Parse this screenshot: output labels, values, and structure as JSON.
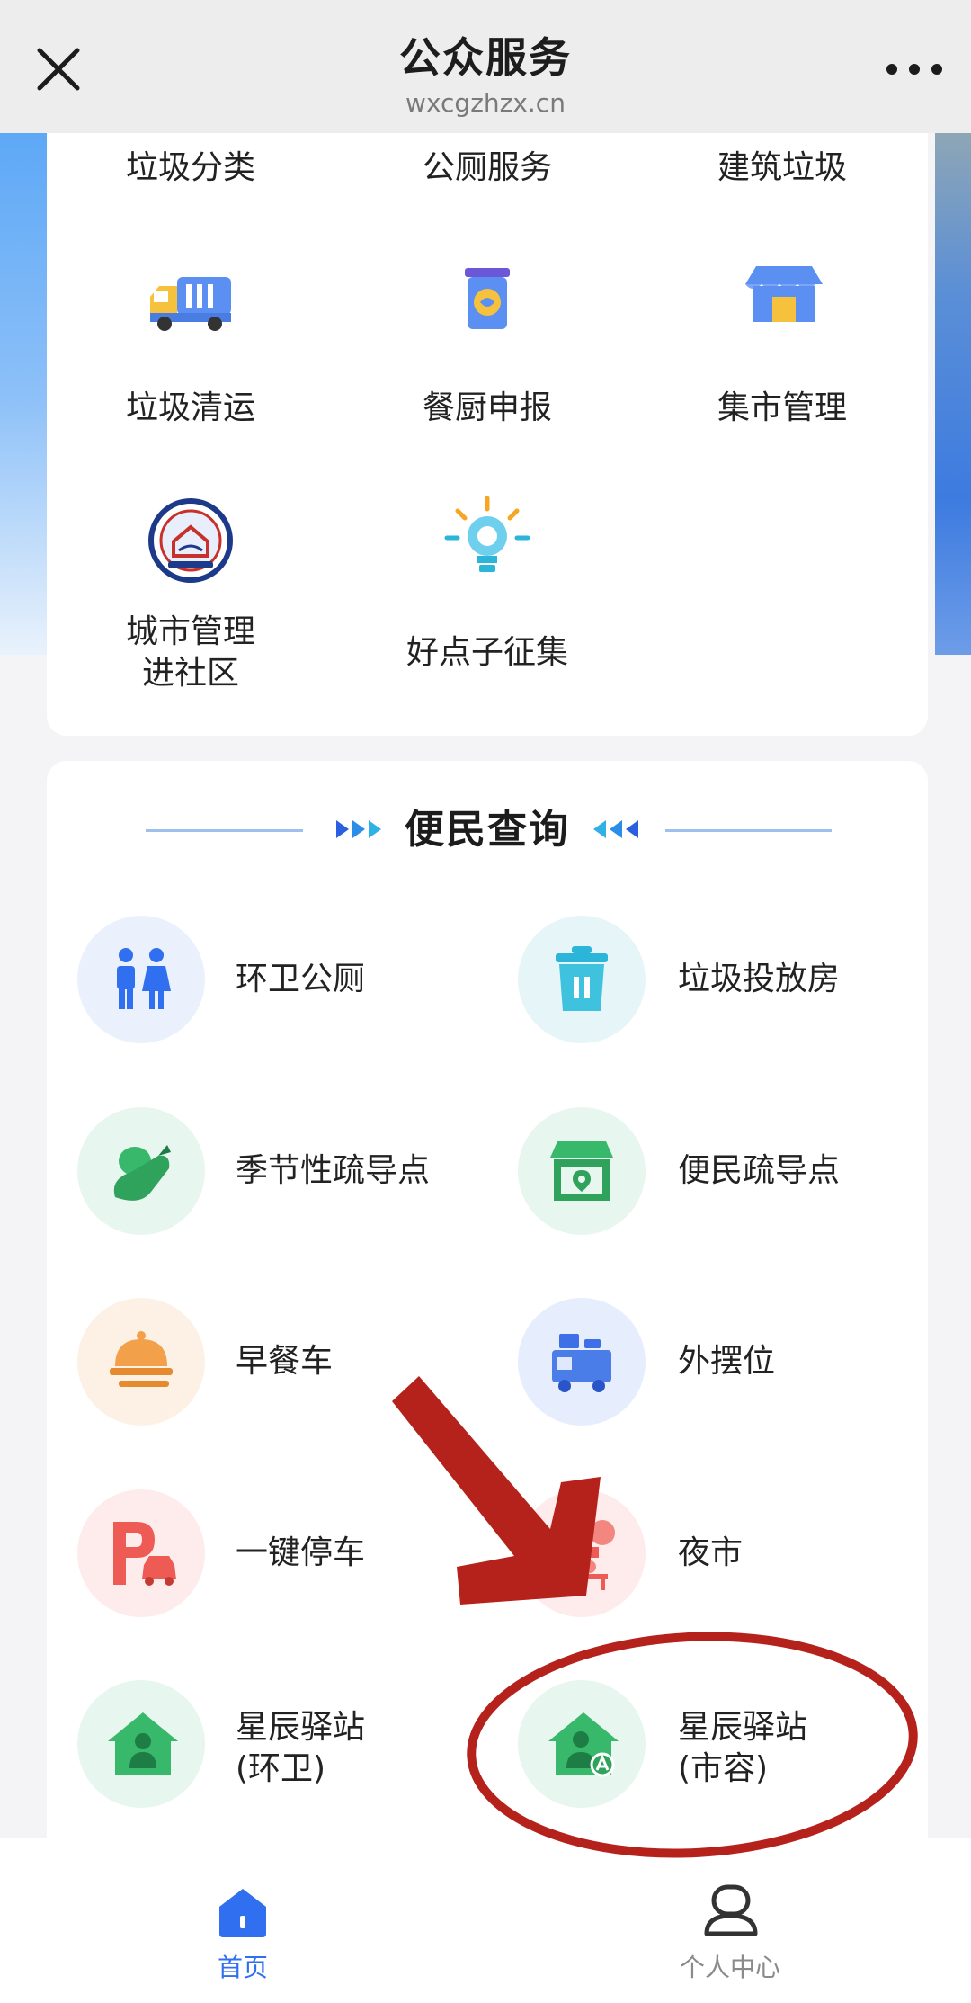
{
  "header": {
    "title": "公众服务",
    "url": "wxcgzhzx.cn"
  },
  "services": {
    "row0": [
      "垃圾分类",
      "公厕服务",
      "建筑垃圾"
    ],
    "items": [
      {
        "label": "垃圾清运",
        "icon": "garbage-truck-icon"
      },
      {
        "label": "餐厨申报",
        "icon": "kitchen-waste-bin-icon"
      },
      {
        "label": "集市管理",
        "icon": "market-stall-icon"
      },
      {
        "label": "城市管理\n进社区",
        "icon": "city-management-community-icon"
      },
      {
        "label": "好点子征集",
        "icon": "lightbulb-idea-icon"
      }
    ]
  },
  "query": {
    "title": "便民查询",
    "items": [
      {
        "label": "环卫公厕",
        "icon": "restroom-icon"
      },
      {
        "label": "垃圾投放房",
        "icon": "trash-can-icon"
      },
      {
        "label": "季节性疏导点",
        "icon": "vegetable-icon"
      },
      {
        "label": "便民疏导点",
        "icon": "store-location-icon"
      },
      {
        "label": "早餐车",
        "icon": "breakfast-cloche-icon"
      },
      {
        "label": "外摆位",
        "icon": "outdoor-stall-truck-icon"
      },
      {
        "label": "一键停车",
        "icon": "parking-icon"
      },
      {
        "label": "夜市",
        "icon": "night-market-icon"
      },
      {
        "label": "星辰驿站\n(环卫)",
        "icon": "station-sanitation-icon"
      },
      {
        "label": "星辰驿站\n(市容)",
        "icon": "station-cityscape-icon"
      }
    ]
  },
  "tabbar": {
    "home": "首页",
    "profile": "个人中心"
  },
  "colors": {
    "accent": "#2f6ff0",
    "annotation": "#b5221c"
  }
}
